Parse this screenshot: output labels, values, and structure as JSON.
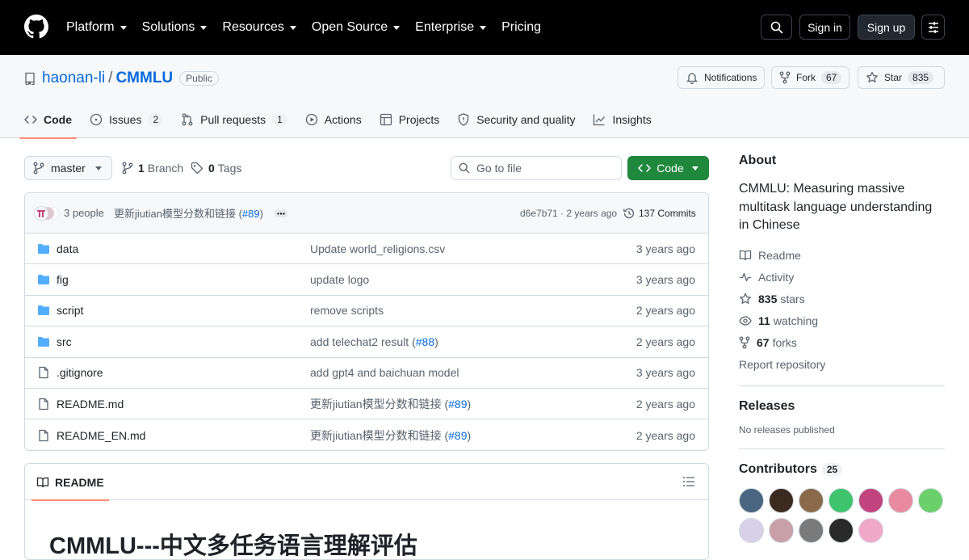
{
  "header": {
    "nav": [
      {
        "label": "Platform",
        "chevron": true
      },
      {
        "label": "Solutions",
        "chevron": true
      },
      {
        "label": "Resources",
        "chevron": true
      },
      {
        "label": "Open Source",
        "chevron": true
      },
      {
        "label": "Enterprise",
        "chevron": true
      },
      {
        "label": "Pricing",
        "chevron": false
      }
    ],
    "sign_in": "Sign in",
    "sign_up": "Sign up"
  },
  "repo": {
    "owner": "haonan-li",
    "slash": "/",
    "name": "CMMLU",
    "visibility": "Public",
    "notifications": "Notifications",
    "fork_label": "Fork",
    "fork_count": "67",
    "star_label": "Star",
    "star_count": "835"
  },
  "tabs": [
    {
      "label": "Code",
      "count": "",
      "icon": "code-icon",
      "selected": true
    },
    {
      "label": "Issues",
      "count": "2",
      "icon": "issue-icon",
      "selected": false
    },
    {
      "label": "Pull requests",
      "count": "1",
      "icon": "pull-request-icon",
      "selected": false
    },
    {
      "label": "Actions",
      "count": "",
      "icon": "play-icon",
      "selected": false
    },
    {
      "label": "Projects",
      "count": "",
      "icon": "table-icon",
      "selected": false
    },
    {
      "label": "Security and quality",
      "count": "",
      "icon": "shield-icon",
      "selected": false
    },
    {
      "label": "Insights",
      "count": "",
      "icon": "graph-icon",
      "selected": false
    }
  ],
  "toolbar": {
    "branch": "master",
    "branch_count": "1",
    "branch_label": "Branch",
    "tag_count": "0",
    "tag_label": "Tags",
    "go_to_file": "Go to file",
    "code_button": "Code"
  },
  "latest_commit": {
    "people": "3 people",
    "message": "更新jiutian模型分数和链接 (",
    "pr": "#89",
    "message_end": ")",
    "hash": "d6e7b71",
    "dot": " · ",
    "age": "2 years ago",
    "commits": "137 Commits"
  },
  "files": [
    {
      "name": "data",
      "type": "folder",
      "msg": "Update world_religions.csv",
      "pr": "",
      "msg_end": "",
      "age": "3 years ago"
    },
    {
      "name": "fig",
      "type": "folder",
      "msg": "update logo",
      "pr": "",
      "msg_end": "",
      "age": "3 years ago"
    },
    {
      "name": "script",
      "type": "folder",
      "msg": "remove scripts",
      "pr": "",
      "msg_end": "",
      "age": "2 years ago"
    },
    {
      "name": "src",
      "type": "folder",
      "msg": "add telechat2 result (",
      "pr": "#88",
      "msg_end": ")",
      "age": "2 years ago"
    },
    {
      "name": ".gitignore",
      "type": "file",
      "msg": "add gpt4 and baichuan model",
      "pr": "",
      "msg_end": "",
      "age": "3 years ago"
    },
    {
      "name": "README.md",
      "type": "file",
      "msg": "更新jiutian模型分数和链接 (",
      "pr": "#89",
      "msg_end": ")",
      "age": "2 years ago"
    },
    {
      "name": "README_EN.md",
      "type": "file",
      "msg": "更新jiutian模型分数和链接 (",
      "pr": "#89",
      "msg_end": ")",
      "age": "2 years ago"
    }
  ],
  "readme": {
    "tab": "README",
    "title": "CMMLU---中文多任务语言理解评估"
  },
  "about": {
    "heading": "About",
    "description": "CMMLU: Measuring massive multitask language understanding in Chinese",
    "readme": "Readme",
    "activity": "Activity",
    "stars_count": "835",
    "stars_label": "stars",
    "watching_count": "11",
    "watching_label": "watching",
    "forks_count": "67",
    "forks_label": "forks",
    "report": "Report repository"
  },
  "releases": {
    "heading": "Releases",
    "none": "No releases published"
  },
  "contributors": {
    "heading": "Contributors",
    "count": "25",
    "avatar_colors": [
      "#4a6680",
      "#3a2a20",
      "#8a6a4a",
      "#3ec46d",
      "#c2447e",
      "#e88aa0",
      "#6bd06b",
      "#d8d0e8",
      "#c9a0a8",
      "#7a7a7a",
      "#2a2a2a",
      "#f0a8c8"
    ]
  }
}
